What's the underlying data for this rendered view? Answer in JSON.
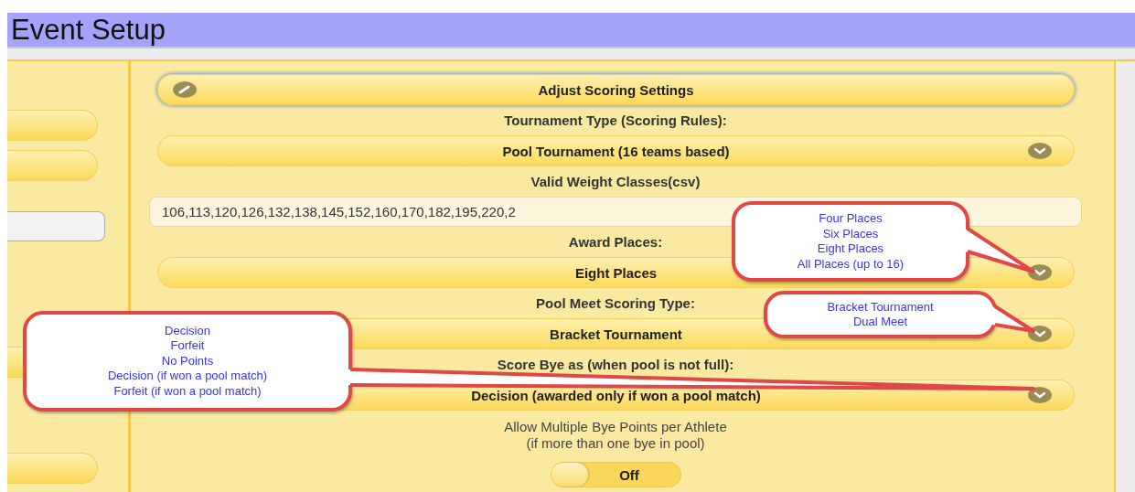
{
  "title": "Event Setup",
  "scoring_button": {
    "label": "Adjust Scoring Settings"
  },
  "fields": [
    {
      "kind": "select",
      "label": "Tournament Type (Scoring Rules):",
      "value": "Pool Tournament (16 teams based)"
    },
    {
      "kind": "text",
      "label": "Valid Weight Classes(csv)",
      "value": "106,113,120,126,132,138,145,152,160,170,182,195,220,2"
    },
    {
      "kind": "select",
      "label": "Award Places:",
      "value": "Eight Places"
    },
    {
      "kind": "select",
      "label": "Pool Meet Scoring Type:",
      "value": "Bracket Tournament"
    },
    {
      "kind": "select",
      "label": "Score Bye as (when pool is not full):",
      "value": "Decision (awarded only if won a pool match)"
    }
  ],
  "bye_points": {
    "label": "Allow Multiple Bye Points per Athlete",
    "note": "(if more than one bye in pool)",
    "on": false,
    "state_text": "Off"
  },
  "callouts": [
    {
      "options": [
        "Four Places",
        "Six Places",
        "Eight Places",
        "All Places (up to 16)"
      ]
    },
    {
      "options": [
        "Bracket Tournament",
        "Dual Meet"
      ]
    },
    {
      "options": [
        "Decision",
        "Forfeit",
        "No Points",
        "Decision (if won a pool match)",
        "Forfeit (if won a pool match)"
      ]
    }
  ]
}
